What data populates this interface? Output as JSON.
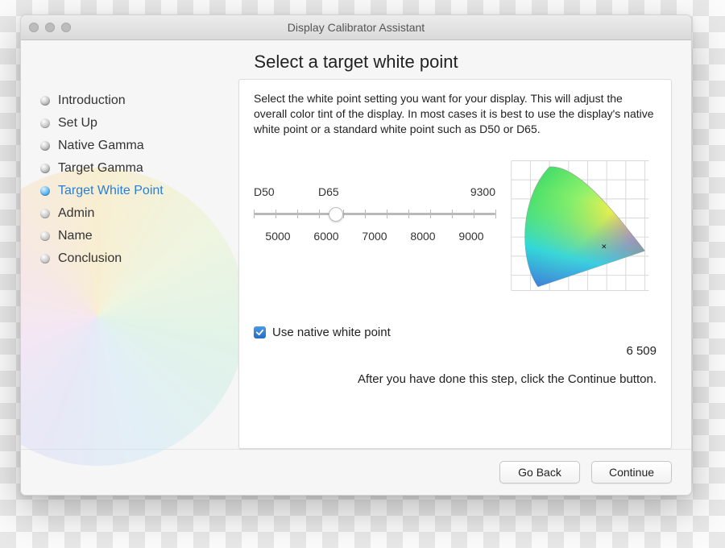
{
  "window": {
    "title": "Display Calibrator Assistant"
  },
  "heading": "Select a target white point",
  "sidebar": {
    "steps": [
      "Introduction",
      "Set Up",
      "Native Gamma",
      "Target Gamma",
      "Target White Point",
      "Admin",
      "Name",
      "Conclusion"
    ]
  },
  "panel": {
    "description": "Select the white point setting you want for your display.  This will adjust the overall color tint of the display.  In most cases it is best to use the display's native white point or a standard white point such as D50 or D65.",
    "slider": {
      "top_labels": [
        "D50",
        "D65",
        "9300"
      ],
      "bottom_labels": [
        "5000",
        "6000",
        "7000",
        "8000",
        "9000"
      ]
    },
    "checkbox_label": "Use native white point",
    "value_readout": "6 509",
    "hint": "After you have done this step, click the Continue button."
  },
  "footer": {
    "back": "Go Back",
    "continue": "Continue"
  }
}
